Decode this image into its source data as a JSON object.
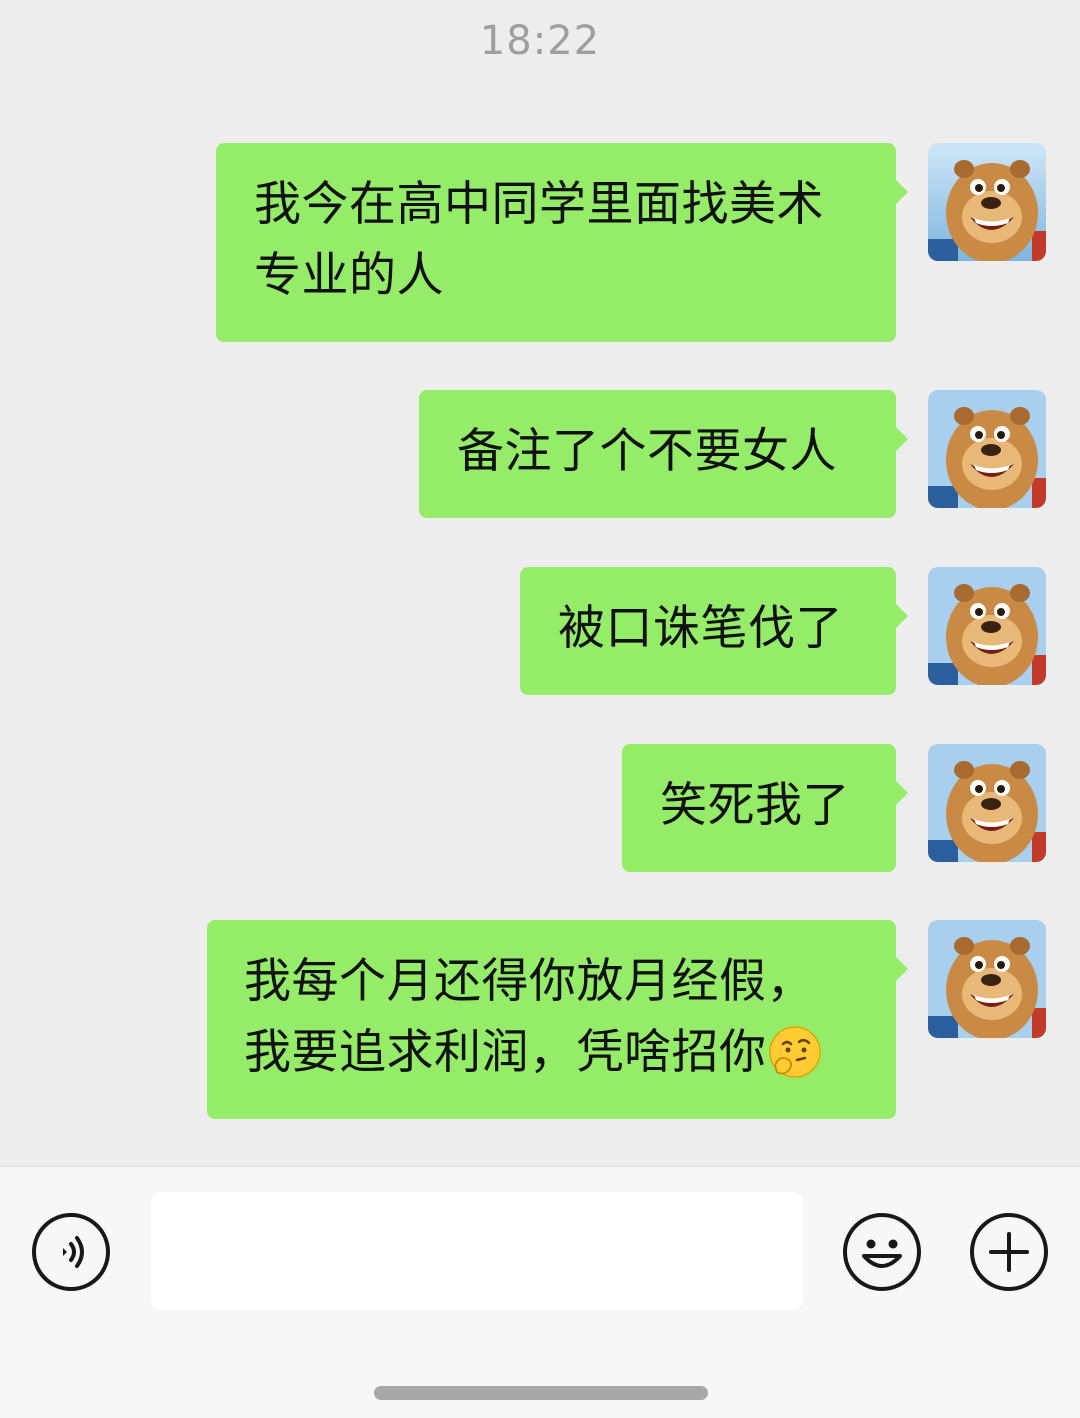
{
  "header": {
    "timestamp": "18:22"
  },
  "messages": [
    {
      "lines": [
        "我今在高中同学里面找美术",
        "专业的人"
      ],
      "sender": "self"
    },
    {
      "lines": [
        "备注了个不要女人"
      ],
      "sender": "self"
    },
    {
      "lines": [
        "被口诛笔伐了"
      ],
      "sender": "self"
    },
    {
      "lines": [
        "笑死我了"
      ],
      "sender": "self"
    },
    {
      "lines": [
        "我每个月还得你放月经假，",
        "我要追求利润，凭啥招你"
      ],
      "sender": "self",
      "trailing_emoji": "thinking-face-emoji"
    }
  ],
  "input_bar": {
    "voice_icon": "voice-icon",
    "input_value": "",
    "emoji_icon": "emoji-icon",
    "plus_icon": "plus-icon"
  },
  "colors": {
    "chat_background": "#ededed",
    "bubble_self": "#95ec69",
    "input_bar_background": "#f7f7f7"
  }
}
